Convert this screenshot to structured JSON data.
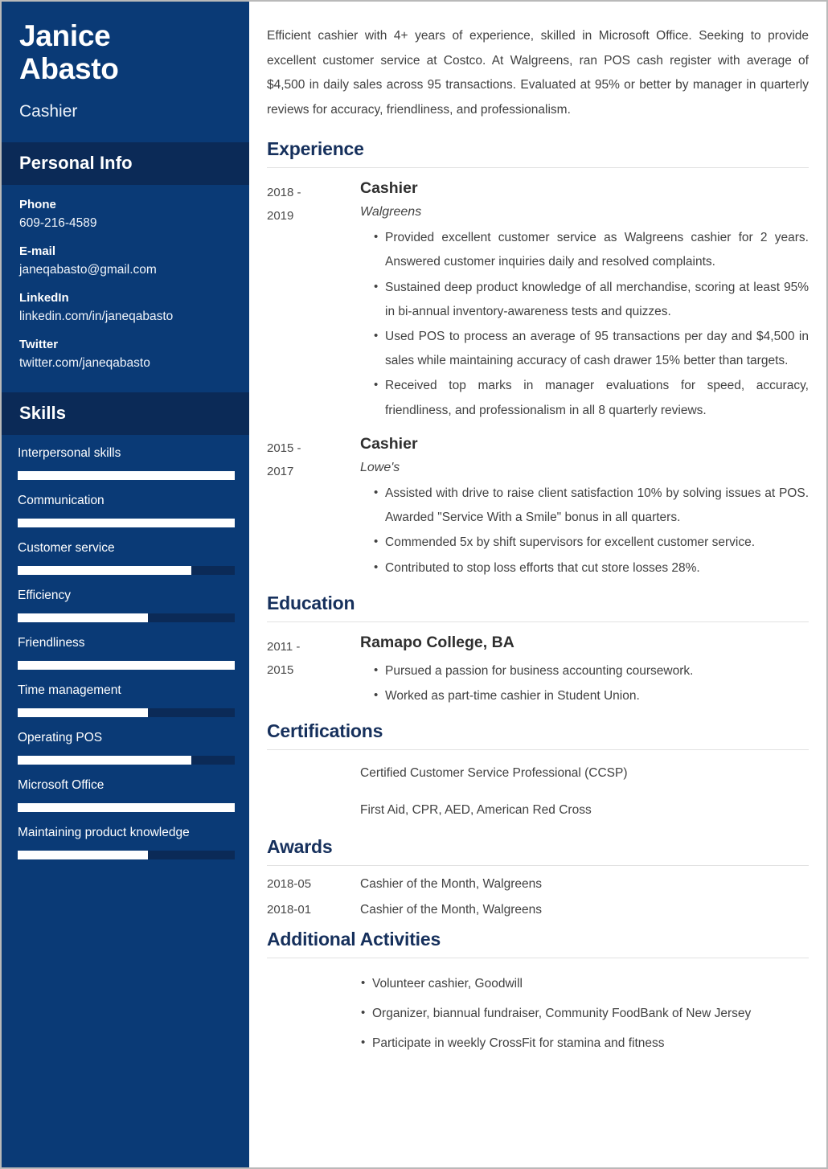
{
  "sidebar": {
    "name_line1": "Janice",
    "name_line2": "Abasto",
    "job_title": "Cashier",
    "personal_info_heading": "Personal Info",
    "contacts": [
      {
        "label": "Phone",
        "value": "609-216-4589"
      },
      {
        "label": "E-mail",
        "value": "janeqabasto@gmail.com"
      },
      {
        "label": "LinkedIn",
        "value": "linkedin.com/in/janeqabasto"
      },
      {
        "label": "Twitter",
        "value": "twitter.com/janeqabasto"
      }
    ],
    "skills_heading": "Skills",
    "skills": [
      {
        "name": "Interpersonal skills",
        "level": 100
      },
      {
        "name": "Communication",
        "level": 100
      },
      {
        "name": "Customer service",
        "level": 80
      },
      {
        "name": "Efficiency",
        "level": 60
      },
      {
        "name": "Friendliness",
        "level": 100
      },
      {
        "name": "Time management",
        "level": 60
      },
      {
        "name": "Operating POS",
        "level": 80
      },
      {
        "name": "Microsoft Office",
        "level": 100
      },
      {
        "name": "Maintaining product knowledge",
        "level": 60
      }
    ]
  },
  "main": {
    "summary": "Efficient cashier with 4+ years of experience, skilled in Microsoft Office. Seeking to provide excellent customer service at Costco. At Walgreens, ran POS cash register with average of $4,500 in daily sales across 95 transactions. Evaluated at 95% or better by manager in quarterly reviews for accuracy, friendliness, and professionalism.",
    "experience": {
      "heading": "Experience",
      "entries": [
        {
          "date_from": "2018 -",
          "date_to": "2019",
          "role": "Cashier",
          "org": "Walgreens",
          "bullets": [
            "Provided excellent customer service as Walgreens cashier for 2 years. Answered customer inquiries daily and resolved complaints.",
            "Sustained deep product knowledge of all merchandise, scoring at least 95% in bi-annual inventory-awareness tests and quizzes.",
            "Used POS to process an average of 95 transactions per day and $4,500 in sales while maintaining accuracy of cash drawer 15% better than targets.",
            "Received top marks in manager evaluations for speed, accuracy, friendliness, and professionalism in all 8 quarterly reviews."
          ]
        },
        {
          "date_from": "2015 -",
          "date_to": "2017",
          "role": "Cashier",
          "org": "Lowe's",
          "bullets": [
            "Assisted with drive to raise client satisfaction 10% by solving issues at POS. Awarded \"Service With a Smile\" bonus in all quarters.",
            "Commended 5x by shift supervisors for excellent customer service.",
            "Contributed to stop loss efforts that cut store losses 28%."
          ]
        }
      ]
    },
    "education": {
      "heading": "Education",
      "entries": [
        {
          "date_from": "2011 -",
          "date_to": "2015",
          "role": "Ramapo College, BA",
          "bullets": [
            "Pursued a passion for business accounting coursework.",
            "Worked as part-time cashier in Student Union."
          ]
        }
      ]
    },
    "certifications": {
      "heading": "Certifications",
      "items": [
        "Certified Customer Service Professional (CCSP)",
        "First Aid, CPR, AED, American Red Cross"
      ]
    },
    "awards": {
      "heading": "Awards",
      "items": [
        {
          "date": "2018-05",
          "text": "Cashier of the Month, Walgreens"
        },
        {
          "date": "2018-01",
          "text": "Cashier of the Month, Walgreens"
        }
      ]
    },
    "additional_activities": {
      "heading": "Additional Activities",
      "items": [
        "Volunteer cashier, Goodwill",
        "Organizer, biannual fundraiser, Community FoodBank of New Jersey",
        "Participate in weekly CrossFit for stamina and fitness"
      ]
    }
  },
  "colors": {
    "sidebar_bg": "#0a3a76",
    "sidebar_band": "#0b2a57",
    "heading_navy": "#16305c",
    "rule": "#e2e2e2"
  }
}
